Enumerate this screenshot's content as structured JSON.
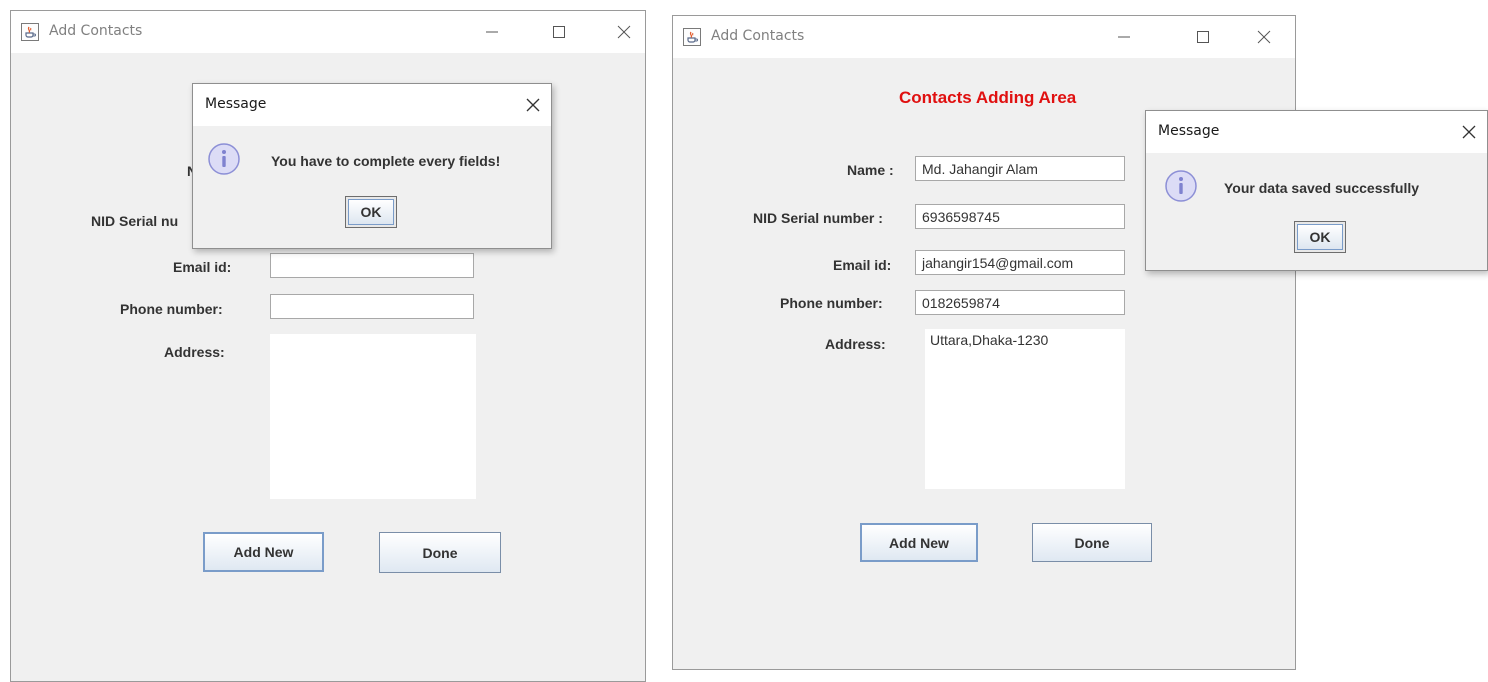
{
  "left_window": {
    "title": "Add Contacts",
    "labels": {
      "name_partial": "N",
      "nid_partial": "NID Serial nu",
      "email": "Email id:",
      "phone": "Phone number:",
      "address": "Address:"
    },
    "values": {
      "email": "",
      "phone": "",
      "address": ""
    },
    "buttons": {
      "add_new": "Add New",
      "done": "Done"
    }
  },
  "left_dialog": {
    "title": "Message",
    "message": "You have to complete every fields!",
    "ok": "OK"
  },
  "right_window": {
    "title": "Add Contacts",
    "heading": "Contacts Adding Area",
    "labels": {
      "name": "Name :",
      "nid": "NID Serial number :",
      "email": "Email id:",
      "phone": "Phone number:",
      "address": "Address:"
    },
    "values": {
      "name": "Md. Jahangir Alam",
      "nid": "6936598745",
      "email": "jahangir154@gmail.com",
      "phone": "0182659874",
      "address": "Uttara,Dhaka-1230"
    },
    "buttons": {
      "add_new": "Add New",
      "done": "Done"
    }
  },
  "right_dialog": {
    "title": "Message",
    "message": "Your data saved successfully",
    "ok": "OK"
  },
  "colors": {
    "heading": "#e01010",
    "window_bg": "#f0f0f0",
    "info_icon": "#8c8fd6"
  },
  "icons": {
    "app": "java-coffee-icon",
    "minimize": "minimize-icon",
    "maximize": "maximize-icon",
    "close": "close-icon",
    "info": "info-icon"
  }
}
